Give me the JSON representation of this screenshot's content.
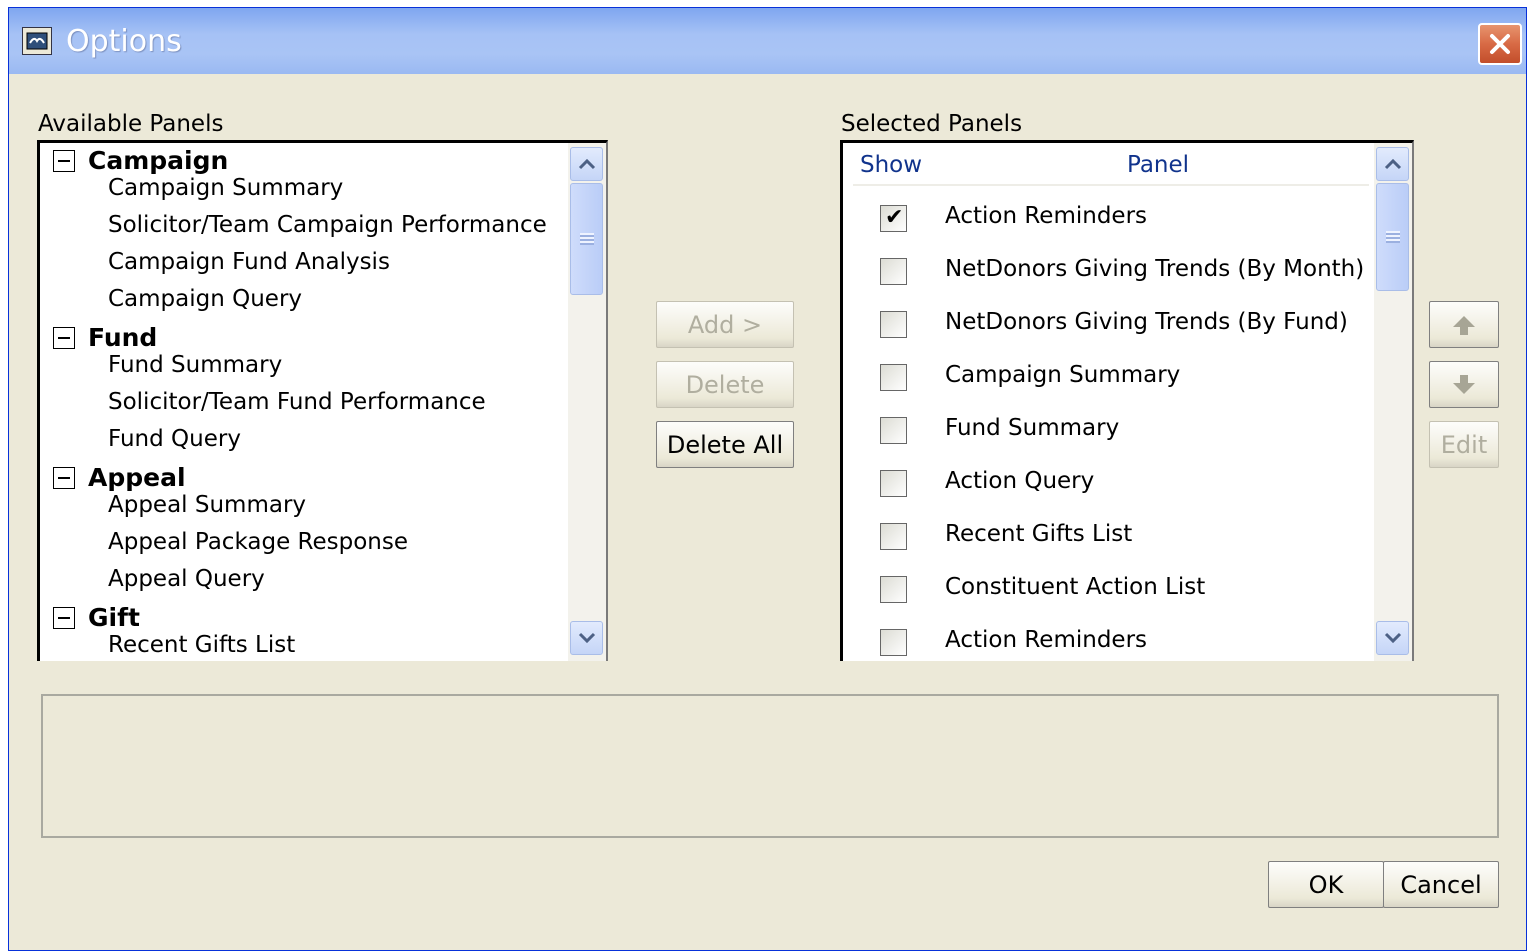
{
  "window": {
    "title": "Options",
    "close_label": "close"
  },
  "available": {
    "label": "Available Panels",
    "groups": [
      {
        "name": "Campaign",
        "items": [
          "Campaign Summary",
          "Solicitor/Team Campaign Performance",
          "Campaign Fund Analysis",
          "Campaign Query"
        ]
      },
      {
        "name": "Fund",
        "items": [
          "Fund Summary",
          "Solicitor/Team Fund Performance",
          "Fund Query"
        ]
      },
      {
        "name": "Appeal",
        "items": [
          "Appeal Summary",
          "Appeal Package Response",
          "Appeal Query"
        ]
      },
      {
        "name": "Gift",
        "items": [
          "Recent Gifts List"
        ]
      }
    ]
  },
  "selected": {
    "label": "Selected Panels",
    "columns": {
      "show": "Show",
      "panel": "Panel"
    },
    "rows": [
      {
        "show": true,
        "panel": "Action Reminders"
      },
      {
        "show": false,
        "panel": "NetDonors Giving Trends (By Month)"
      },
      {
        "show": false,
        "panel": "NetDonors Giving Trends (By Fund)"
      },
      {
        "show": false,
        "panel": "Campaign Summary"
      },
      {
        "show": false,
        "panel": "Fund Summary"
      },
      {
        "show": false,
        "panel": "Action Query"
      },
      {
        "show": false,
        "panel": "Recent Gifts List"
      },
      {
        "show": false,
        "panel": "Constituent Action List"
      },
      {
        "show": false,
        "panel": "Action Reminders"
      }
    ]
  },
  "buttons": {
    "add": "Add >",
    "delete": "Delete",
    "delete_all": "Delete All",
    "edit": "Edit",
    "ok": "OK",
    "cancel": "Cancel"
  },
  "colors": {
    "title_bar": "#a6c2f5",
    "header_text": "#10338c",
    "dialog_bg": "#ece9d8"
  }
}
